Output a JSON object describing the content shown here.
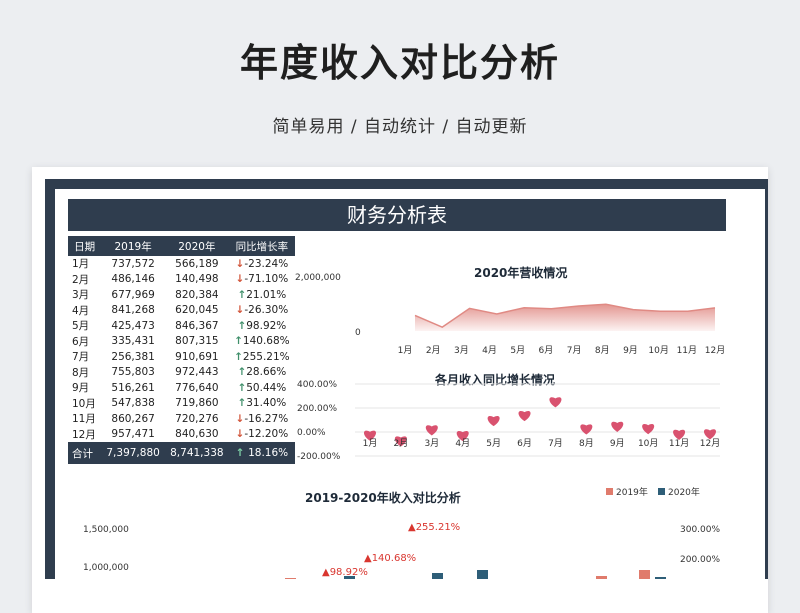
{
  "hero": {
    "title": "年度收入对比分析",
    "subtitle": "简单易用 / 自动统计 / 自动更新"
  },
  "sheet": {
    "title": "财务分析表"
  },
  "table": {
    "headers": [
      "日期",
      "2019年",
      "2020年",
      "同比增长率"
    ],
    "rows": [
      {
        "month": "1月",
        "y2019": "737,572",
        "y2020": "566,189",
        "rate": "-23.24%",
        "dir": "down"
      },
      {
        "month": "2月",
        "y2019": "486,146",
        "y2020": "140,498",
        "rate": "-71.10%",
        "dir": "down"
      },
      {
        "month": "3月",
        "y2019": "677,969",
        "y2020": "820,384",
        "rate": "21.01%",
        "dir": "up"
      },
      {
        "month": "4月",
        "y2019": "841,268",
        "y2020": "620,045",
        "rate": "-26.30%",
        "dir": "down"
      },
      {
        "month": "5月",
        "y2019": "425,473",
        "y2020": "846,367",
        "rate": "98.92%",
        "dir": "up"
      },
      {
        "month": "6月",
        "y2019": "335,431",
        "y2020": "807,315",
        "rate": "140.68%",
        "dir": "up"
      },
      {
        "month": "7月",
        "y2019": "256,381",
        "y2020": "910,691",
        "rate": "255.21%",
        "dir": "up"
      },
      {
        "month": "8月",
        "y2019": "755,803",
        "y2020": "972,443",
        "rate": "28.66%",
        "dir": "up"
      },
      {
        "month": "9月",
        "y2019": "516,261",
        "y2020": "776,640",
        "rate": "50.44%",
        "dir": "up"
      },
      {
        "month": "10月",
        "y2019": "547,838",
        "y2020": "719,860",
        "rate": "31.40%",
        "dir": "up"
      },
      {
        "month": "11月",
        "y2019": "860,267",
        "y2020": "720,276",
        "rate": "-16.27%",
        "dir": "down"
      },
      {
        "month": "12月",
        "y2019": "957,471",
        "y2020": "840,630",
        "rate": "-12.20%",
        "dir": "down"
      }
    ],
    "total": {
      "label": "合计",
      "y2019": "7,397,880",
      "y2020": "8,741,338",
      "rate": "18.16%",
      "dir": "up"
    }
  },
  "colors": {
    "header": "#2f3d4e",
    "up": "#3f8f6a",
    "down": "#d2553a",
    "area": "#e08a84",
    "heart": "#d9526f",
    "s2019": "#e07b6c",
    "s2020": "#2e5e78"
  },
  "chart_data": [
    {
      "type": "area",
      "title": "2020年营收情况",
      "categories": [
        "1月",
        "2月",
        "3月",
        "4月",
        "5月",
        "6月",
        "7月",
        "8月",
        "9月",
        "10月",
        "11月",
        "12月"
      ],
      "values": [
        566189,
        140498,
        820384,
        620045,
        846367,
        807315,
        910691,
        972443,
        776640,
        719860,
        720276,
        840630
      ],
      "yticks": [
        "2,000,000",
        "0"
      ],
      "ylim": [
        0,
        2000000
      ]
    },
    {
      "type": "scatter",
      "title": "各月收入同比增长情况",
      "categories": [
        "1月",
        "2月",
        "3月",
        "4月",
        "5月",
        "6月",
        "7月",
        "8月",
        "9月",
        "10月",
        "11月",
        "12月"
      ],
      "values": [
        -23.24,
        -71.1,
        21.01,
        -26.3,
        98.92,
        140.68,
        255.21,
        28.66,
        50.44,
        31.4,
        -16.27,
        -12.2
      ],
      "yticks": [
        "400.00%",
        "200.00%",
        "0.00%",
        "-200.00%"
      ],
      "ylim": [
        -200,
        400
      ]
    },
    {
      "type": "bar",
      "title": "2019-2020年收入对比分析",
      "legend": [
        "2019年",
        "2020年"
      ],
      "yticks_left": [
        "1,500,000",
        "1,000,000"
      ],
      "yticks_right": [
        "300.00%",
        "200.00%"
      ],
      "labels": [
        "▲255.21%",
        "▲140.68%",
        "▲98.92%"
      ]
    }
  ]
}
